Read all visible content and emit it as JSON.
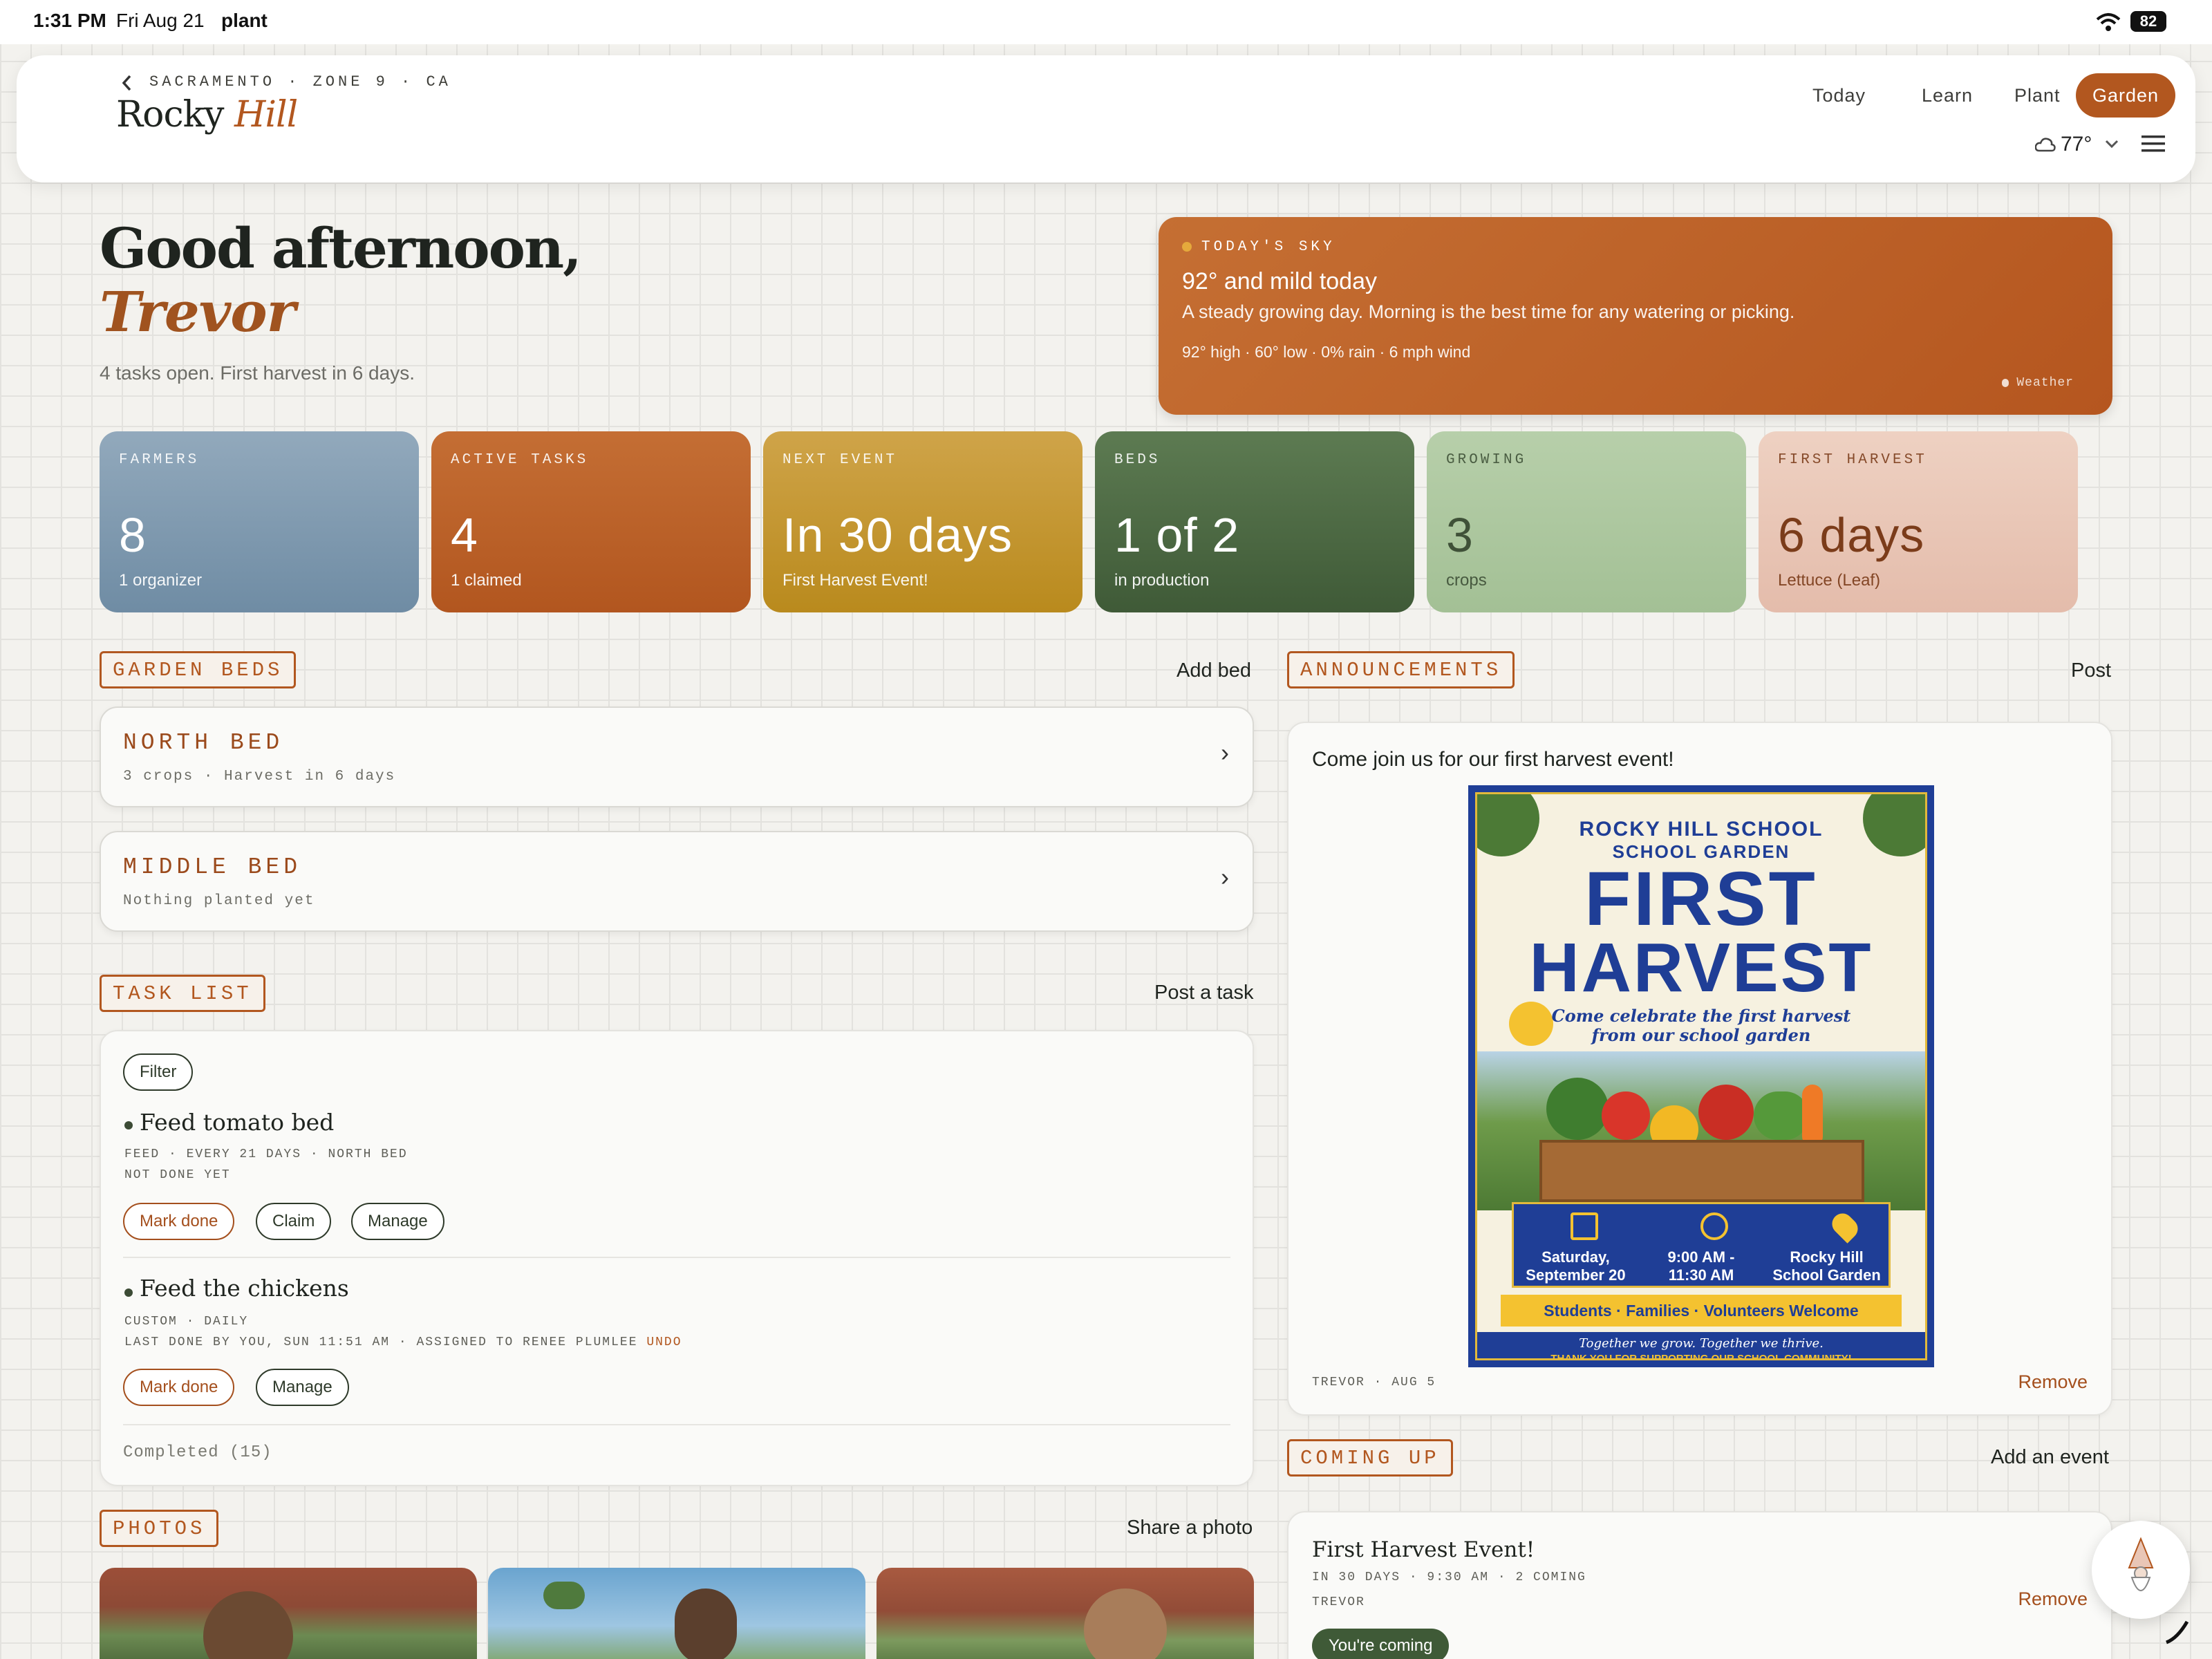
{
  "status_bar": {
    "time": "1:31 PM",
    "date": "Fri Aug 21",
    "app": "plant",
    "battery": "82"
  },
  "header": {
    "location": "SACRAMENTO · ZONE 9 · CA",
    "garden_name_a": "Rocky",
    "garden_name_b": "Hill",
    "nav": [
      "Today",
      "Learn",
      "Plant",
      "Garden"
    ],
    "active_nav": "Garden",
    "temperature": "77°"
  },
  "greeting": {
    "line1": "Good afternoon,",
    "name": "Trevor",
    "summary": "4 tasks open. First harvest in 6 days."
  },
  "sky": {
    "label": "TODAY'S SKY",
    "headline": "92° and mild today",
    "description": "A steady growing day. Morning is the best time for any watering or picking.",
    "stats": "92° high · 60° low · 0% rain · 6 mph wind",
    "source": "Weather"
  },
  "stats": [
    {
      "label": "FARMERS",
      "value": "8",
      "sub": "1 organizer",
      "color": "#7f9ab0"
    },
    {
      "label": "ACTIVE TASKS",
      "value": "4",
      "sub": "1 claimed",
      "color": "#b8602a"
    },
    {
      "label": "NEXT EVENT",
      "value": "In 30 days",
      "sub": "First Harvest Event!",
      "color": "#c4952c"
    },
    {
      "label": "BEDS",
      "value": "1 of 2",
      "sub": "in production",
      "color": "#4f6e45"
    },
    {
      "label": "GROWING",
      "value": "3",
      "sub": "crops",
      "color": "#adc7a1"
    },
    {
      "label": "FIRST HARVEST",
      "value": "6 days",
      "sub": "Lettuce (Leaf)",
      "color": "#e9c6b6"
    }
  ],
  "garden_beds": {
    "title": "GARDEN BEDS",
    "action": "Add bed",
    "items": [
      {
        "name": "NORTH BED",
        "sub": "3 crops · Harvest in 6 days"
      },
      {
        "name": "MIDDLE BED",
        "sub": "Nothing planted yet"
      }
    ]
  },
  "tasks": {
    "title": "TASK LIST",
    "action": "Post a task",
    "filter": "Filter",
    "items": [
      {
        "title": "Feed tomato bed",
        "meta1": "FEED · EVERY 21 DAYS · NORTH BED",
        "meta2": "NOT DONE YET",
        "buttons": [
          "Mark done",
          "Claim",
          "Manage"
        ]
      },
      {
        "title": "Feed the chickens",
        "meta1": "CUSTOM · DAILY",
        "meta2": "LAST DONE BY YOU, SUN 11:51 AM · ASSIGNED TO RENEE PLUMLEE",
        "undo": "UNDO",
        "buttons": [
          "Mark done",
          "Manage"
        ]
      }
    ],
    "completed": "Completed (15)"
  },
  "photos": {
    "title": "PHOTOS",
    "action": "Share a photo"
  },
  "announcements": {
    "title": "ANNOUNCEMENTS",
    "action": "Post",
    "message": "Come join us for our first harvest event!",
    "author": "TREVOR · AUG 5",
    "remove": "Remove",
    "poster": {
      "school": "ROCKY HILL SCHOOL",
      "garden": "SCHOOL GARDEN",
      "title1": "FIRST",
      "title2": "HARVEST",
      "tagline1": "Come celebrate the first harvest",
      "tagline2": "from our school garden",
      "date1": "Saturday,",
      "date2": "September 20",
      "time1": "9:00 AM -",
      "time2": "11:30 AM",
      "place1": "Rocky Hill",
      "place2": "School Garden",
      "welcome": "Students · Families · Volunteers Welcome",
      "footer1": "Together we grow. Together we thrive.",
      "footer2": "THANK YOU FOR SUPPORTING OUR SCHOOL COMMUNITY!"
    }
  },
  "coming_up": {
    "title": "COMING UP",
    "action": "Add an event",
    "event_title": "First Harvest Event!",
    "event_meta": "IN 30 DAYS · 9:30 AM · 2 COMING",
    "event_author": "TREVOR",
    "remove": "Remove",
    "rsvp": "You're coming"
  }
}
